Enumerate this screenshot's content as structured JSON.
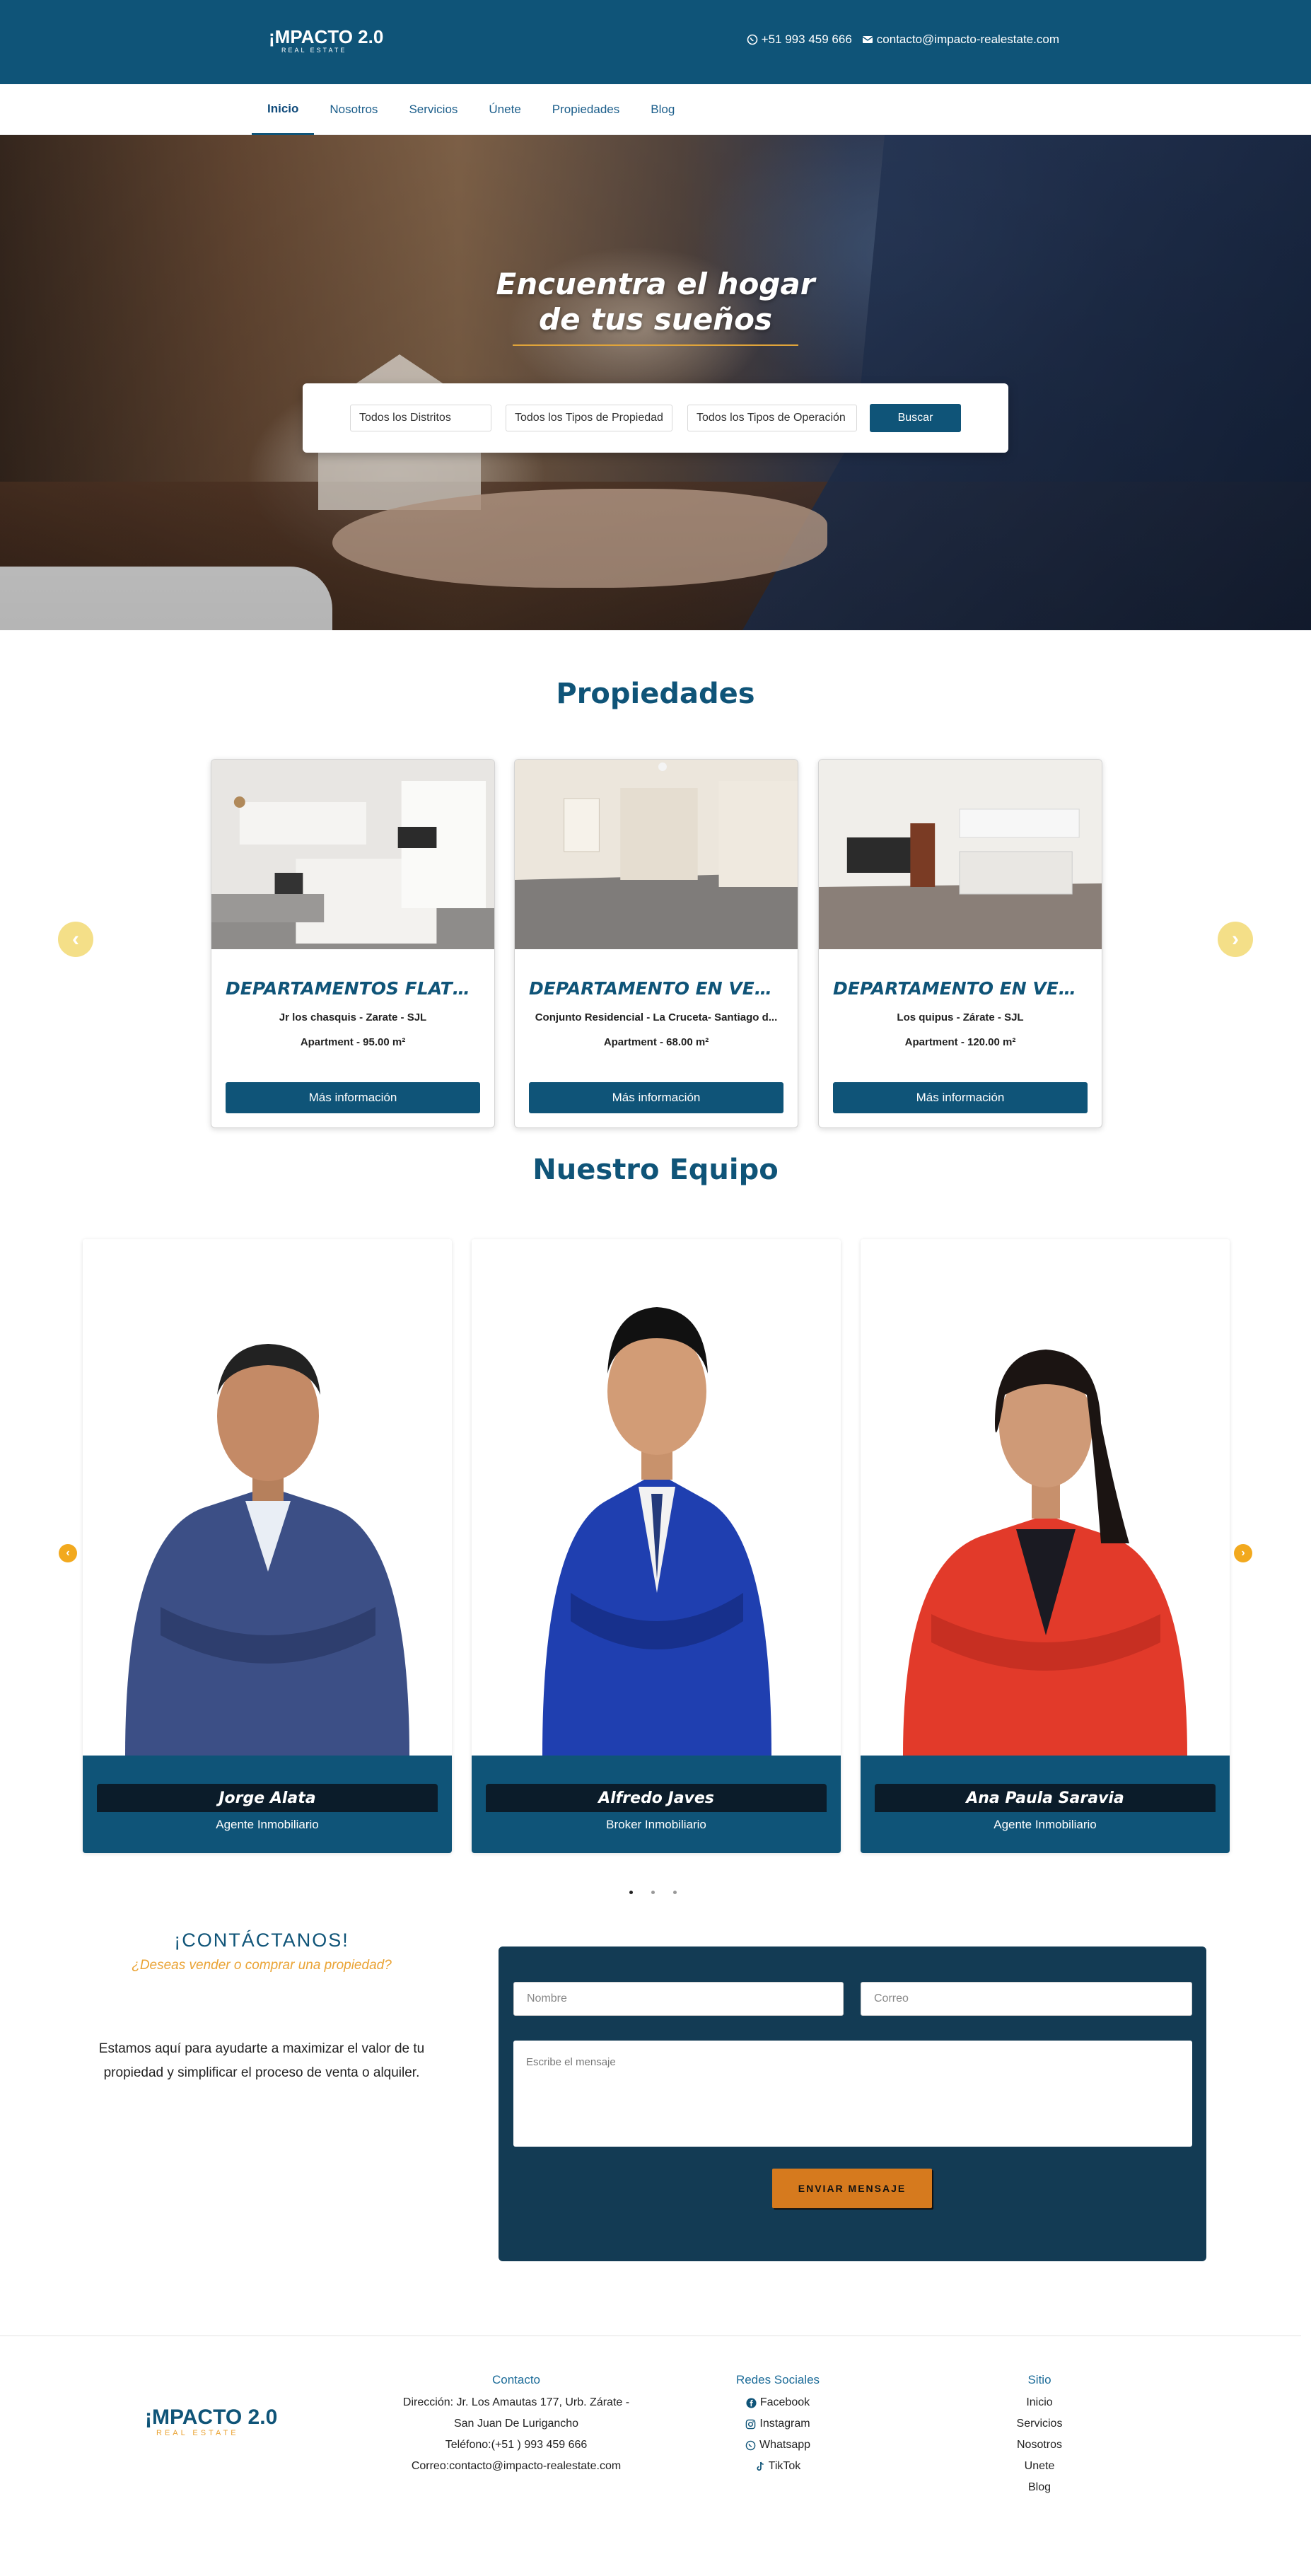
{
  "brand": {
    "logo_main": "¡MPACTO 2.0",
    "logo_sub": "REAL ESTATE"
  },
  "header": {
    "phone": "+51 993 459 666",
    "email": "contacto@impacto-realestate.com"
  },
  "nav": {
    "items": [
      {
        "label": "Inicio",
        "active": true
      },
      {
        "label": "Nosotros"
      },
      {
        "label": "Servicios"
      },
      {
        "label": "Únete"
      },
      {
        "label": "Propiedades"
      },
      {
        "label": "Blog"
      }
    ]
  },
  "hero": {
    "title_line1": "Encuentra el hogar",
    "title_line2": "de tus sueños",
    "search": {
      "district": "Todos los Distritos",
      "property_type": "Todos los Tipos de Propiedad",
      "operation_type": "Todos los Tipos de Operación",
      "button": "Buscar"
    }
  },
  "properties": {
    "title": "Propiedades",
    "cards": [
      {
        "title": "DEPARTAMENTOS FLATS E...",
        "address": "Jr los chasquis - Zarate - SJL",
        "meta": "Apartment - 95.00 m²",
        "button": "Más información"
      },
      {
        "title": "DEPARTAMENTO EN VENTA...",
        "address": "Conjunto Residencial - La Cruceta- Santiago d...",
        "meta": "Apartment - 68.00 m²",
        "button": "Más información"
      },
      {
        "title": "DEPARTAMENTO EN VENTA...",
        "address": "Los quipus - Zárate - SJL",
        "meta": "Apartment - 120.00 m²",
        "button": "Más información"
      }
    ]
  },
  "team": {
    "title": "Nuestro Equipo",
    "members": [
      {
        "name": "Jorge Alata",
        "role": "Agente Inmobiliario",
        "suit": "#3c4f86",
        "shirt": "#e9eef5"
      },
      {
        "name": "Alfredo Javes",
        "role": "Broker Inmobiliario",
        "suit": "#1f3fb0",
        "shirt": "#f2f2f2"
      },
      {
        "name": "Ana Paula Saravia",
        "role": "Agente Inmobiliario",
        "suit": "#e23a2a",
        "shirt": "#1a1a22"
      }
    ]
  },
  "contact": {
    "title": "¡CONTÁCTANOS!",
    "subtitle": "¿Deseas vender o comprar una propiedad?",
    "text": "Estamos aquí para ayudarte a maximizar el valor de tu propiedad y simplificar el proceso de venta o alquiler.",
    "form": {
      "name_placeholder": "Nombre",
      "email_placeholder": "Correo",
      "message_placeholder": "Escribe el mensaje",
      "submit": "ENVIAR MENSAJE"
    }
  },
  "footer": {
    "contact": {
      "title": "Contacto",
      "address_line1": "Dirección: Jr. Los Amautas 177, Urb. Zárate -",
      "address_line2": "San Juan De Lurigancho",
      "phone": "Teléfono:(+51 ) 993 459 666",
      "email": "Correo:contacto@impacto-realestate.com"
    },
    "social": {
      "title": "Redes Sociales",
      "items": [
        "Facebook",
        "Instagram",
        "Whatsapp",
        "TikTok"
      ]
    },
    "site": {
      "title": "Sitio",
      "items": [
        "Inicio",
        "Servicios",
        "Nosotros",
        "Unete",
        "Blog"
      ]
    }
  },
  "colors": {
    "primary": "#0f5478",
    "accent": "#eaa334",
    "button_orange": "#d67a1e",
    "form_bg": "#133b54"
  }
}
